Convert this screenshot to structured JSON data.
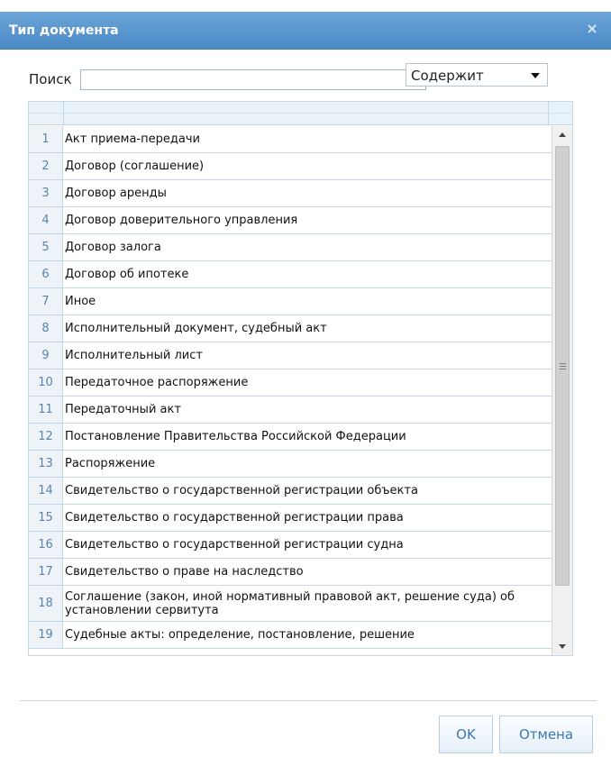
{
  "dialog": {
    "title": "Тип документа",
    "close_glyph": "×"
  },
  "search": {
    "label": "Поиск",
    "value": "",
    "placeholder": ""
  },
  "mode": {
    "selected": "Содержит"
  },
  "rows": [
    {
      "num": "1",
      "label": "Акт приема-передачи"
    },
    {
      "num": "2",
      "label": "Договор (соглашение)"
    },
    {
      "num": "3",
      "label": "Договор аренды"
    },
    {
      "num": "4",
      "label": "Договор доверительного управления"
    },
    {
      "num": "5",
      "label": "Договор залога"
    },
    {
      "num": "6",
      "label": "Договор об ипотеке"
    },
    {
      "num": "7",
      "label": "Иное"
    },
    {
      "num": "8",
      "label": "Исполнительный документ, судебный акт"
    },
    {
      "num": "9",
      "label": "Исполнительный лист"
    },
    {
      "num": "10",
      "label": "Передаточное распоряжение"
    },
    {
      "num": "11",
      "label": "Передаточный акт"
    },
    {
      "num": "12",
      "label": "Постановление Правительства Российской Федерации"
    },
    {
      "num": "13",
      "label": "Распоряжение"
    },
    {
      "num": "14",
      "label": "Свидетельство о государственной регистрации объекта"
    },
    {
      "num": "15",
      "label": "Свидетельство о государственной регистрации права"
    },
    {
      "num": "16",
      "label": "Свидетельство о государственной регистрации судна"
    },
    {
      "num": "17",
      "label": "Свидетельство о праве на наследство"
    },
    {
      "num": "18",
      "label": "Соглашение (закон, иной нормативный правовой акт, решение суда) об установлении сервитута"
    },
    {
      "num": "19",
      "label": "Судебные акты: определение, постановление, решение"
    }
  ],
  "buttons": {
    "ok": "OK",
    "cancel": "Отмена"
  }
}
